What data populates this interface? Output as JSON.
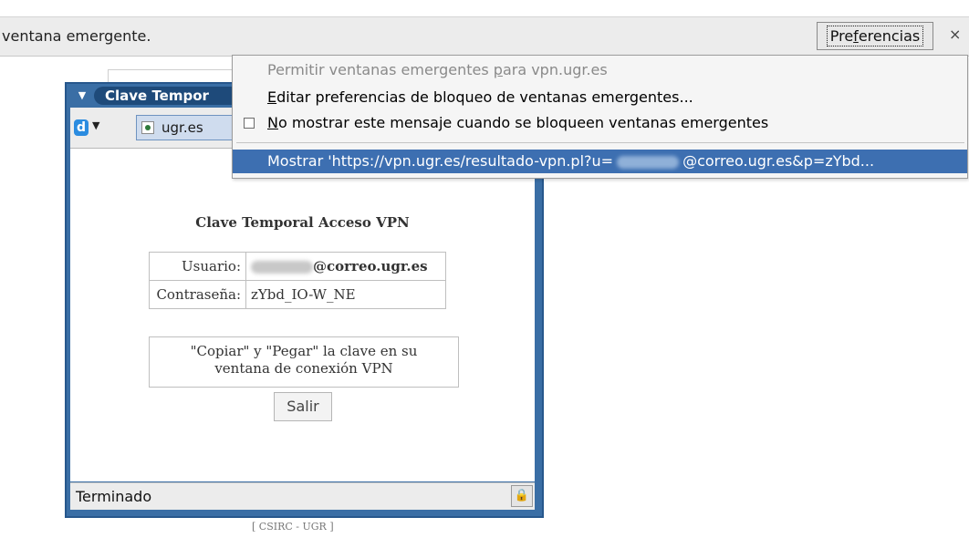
{
  "notification_bar": {
    "message": "ventana emergente.",
    "preferences_button_prefix": "Pre",
    "preferences_button_accel": "f",
    "preferences_button_suffix": "erencias",
    "close_label": "×"
  },
  "popup_menu": {
    "items": [
      {
        "prefix": "Permitir ventanas emergentes ",
        "accel": "p",
        "suffix": "ara vpn.ugr.es",
        "enabled": false
      },
      {
        "prefix": "",
        "accel": "E",
        "suffix": "ditar preferencias de bloqueo de ventanas emergentes...",
        "enabled": true
      },
      {
        "prefix": "",
        "accel": "N",
        "suffix": "o mostrar este mensaje cuando se bloqueen ventanas emergentes",
        "enabled": true,
        "checkbox": false
      }
    ],
    "highlighted_item": {
      "prefix": "Mostrar 'https://vpn.ugr.es/resultado-vpn.pl?u=",
      "suffix": "@correo.ugr.es&p=zYbd..."
    }
  },
  "popup_window": {
    "title": "Clave Tempor",
    "url": "ugr.es",
    "page_title": "Clave Temporal Acceso VPN",
    "credentials": [
      {
        "label": "Usuario:",
        "value": "@correo.ugr.es"
      },
      {
        "label": "Contraseña:",
        "value": "zYbd_IO-W_NE"
      }
    ],
    "note_line1": "\"Copiar\" y \"Pegar\" la clave en su",
    "note_line2": "ventana de conexión VPN",
    "exit_button": "Salir",
    "status": "Terminado"
  },
  "footer": "[ CSIRC - UGR ]",
  "colors": {
    "window_border": "#3a6ea5",
    "menu_highlight": "#3d6fb1"
  }
}
